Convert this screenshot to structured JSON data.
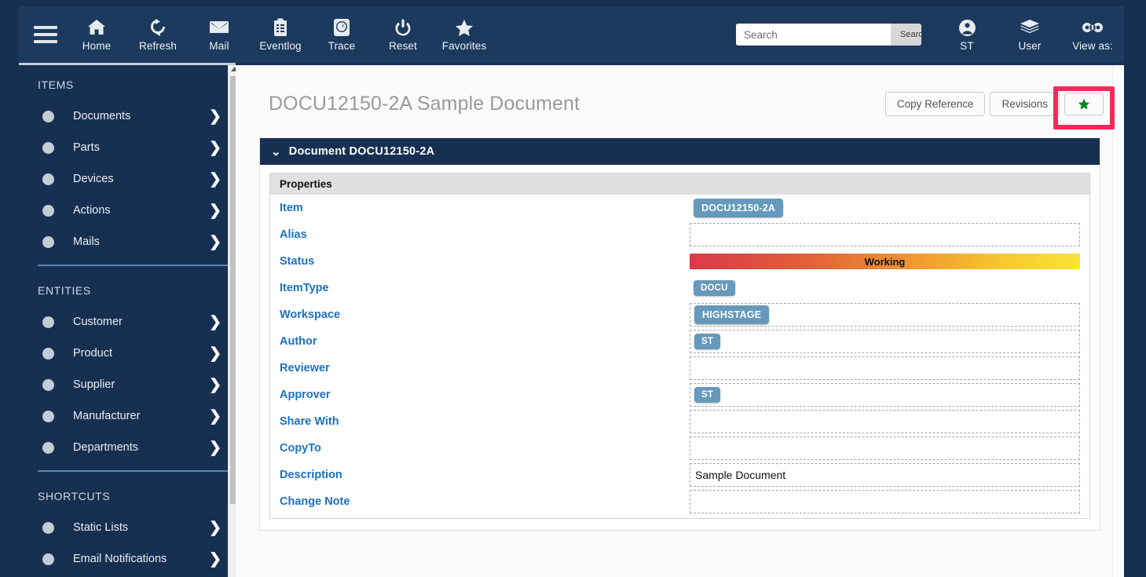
{
  "header": {
    "menu_icon": "hamburger-icon",
    "nav": [
      {
        "label": "Home",
        "icon": "home-icon"
      },
      {
        "label": "Refresh",
        "icon": "refresh-icon"
      },
      {
        "label": "Mail",
        "icon": "mail-icon"
      },
      {
        "label": "Eventlog",
        "icon": "clipboard-icon"
      },
      {
        "label": "Trace",
        "icon": "gauge-icon"
      },
      {
        "label": "Reset",
        "icon": "power-icon"
      },
      {
        "label": "Favorites",
        "icon": "star-icon"
      }
    ],
    "search": {
      "value": "",
      "placeholder": "Search",
      "button_label": "Search"
    },
    "right_nav": [
      {
        "label": "ST",
        "icon": "user-circle-icon"
      },
      {
        "label": "User",
        "icon": "layers-icon"
      },
      {
        "label": "View as:",
        "icon": "mask-icon"
      }
    ]
  },
  "sidebar": {
    "sections": [
      {
        "title": "ITEMS",
        "items": [
          {
            "label": "Documents"
          },
          {
            "label": "Parts"
          },
          {
            "label": "Devices"
          },
          {
            "label": "Actions"
          },
          {
            "label": "Mails"
          }
        ]
      },
      {
        "title": "ENTITIES",
        "items": [
          {
            "label": "Customer"
          },
          {
            "label": "Product"
          },
          {
            "label": "Supplier"
          },
          {
            "label": "Manufacturer"
          },
          {
            "label": "Departments"
          }
        ]
      },
      {
        "title": "SHORTCUTS",
        "items": [
          {
            "label": "Static Lists"
          },
          {
            "label": "Email Notifications"
          }
        ]
      }
    ]
  },
  "main": {
    "page_title": "DOCU12150-2A Sample Document",
    "actions": {
      "copy_reference": "Copy Reference",
      "revisions": "Revisions",
      "favorite_icon": "star-icon"
    },
    "highlight_color": "#f52a5c",
    "panel": {
      "title": "Document DOCU12150-2A",
      "collapse_icon": "chevron-down-icon",
      "properties_title": "Properties",
      "rows": [
        {
          "label": "Item",
          "type": "chip",
          "value": "DOCU12150-2A",
          "boxed": false
        },
        {
          "label": "Alias",
          "type": "empty",
          "value": "",
          "boxed": true
        },
        {
          "label": "Status",
          "type": "status",
          "value": "Working",
          "boxed": false
        },
        {
          "label": "ItemType",
          "type": "chip",
          "value": "DOCU",
          "boxed": false
        },
        {
          "label": "Workspace",
          "type": "chip",
          "value": "HIGHSTAGE",
          "boxed": true
        },
        {
          "label": "Author",
          "type": "chip",
          "value": "ST",
          "boxed": true
        },
        {
          "label": "Reviewer",
          "type": "empty",
          "value": "",
          "boxed": true
        },
        {
          "label": "Approver",
          "type": "chip",
          "value": "ST",
          "boxed": true
        },
        {
          "label": "Share With",
          "type": "empty",
          "value": "",
          "boxed": true
        },
        {
          "label": "CopyTo",
          "type": "empty",
          "value": "",
          "boxed": true
        },
        {
          "label": "Description",
          "type": "text",
          "value": "Sample Document",
          "boxed": true
        },
        {
          "label": "Change Note",
          "type": "empty",
          "value": "",
          "boxed": true
        }
      ]
    }
  }
}
